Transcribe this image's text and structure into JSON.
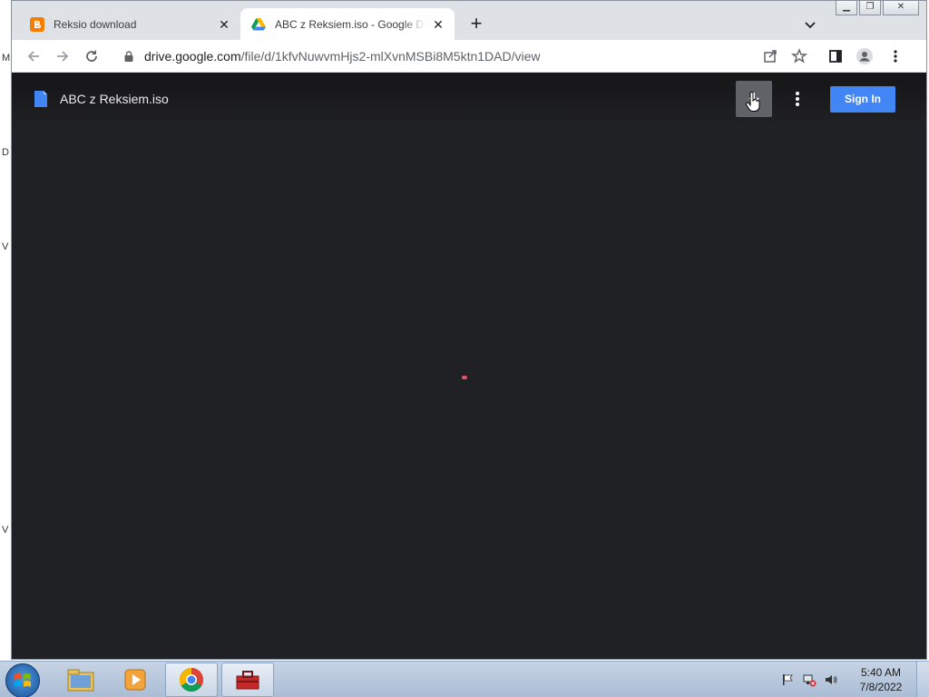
{
  "desktop": {
    "edge_letters": [
      "M",
      "D",
      "V",
      "V"
    ]
  },
  "browser": {
    "tabs": [
      {
        "title": "Reksio download",
        "icon": "blogger-icon",
        "active": false
      },
      {
        "title": "ABC z Reksiem.iso - Google Drive",
        "icon": "google-drive-icon",
        "active": true
      }
    ],
    "address": {
      "host": "drive.google.com",
      "path": "/file/d/1kfvNuwvmHjs2-mlXvnMSBi8M5ktn1DAD/view"
    }
  },
  "viewer": {
    "file_name": "ABC z Reksiem.iso",
    "sign_in_label": "Sign In"
  },
  "taskbar": {
    "clock_time": "5:40 AM",
    "clock_date": "7/8/2022"
  },
  "colors": {
    "viewer_bg": "#202124",
    "sign_in": "#4285f4",
    "loading_dot": "#e05267"
  }
}
